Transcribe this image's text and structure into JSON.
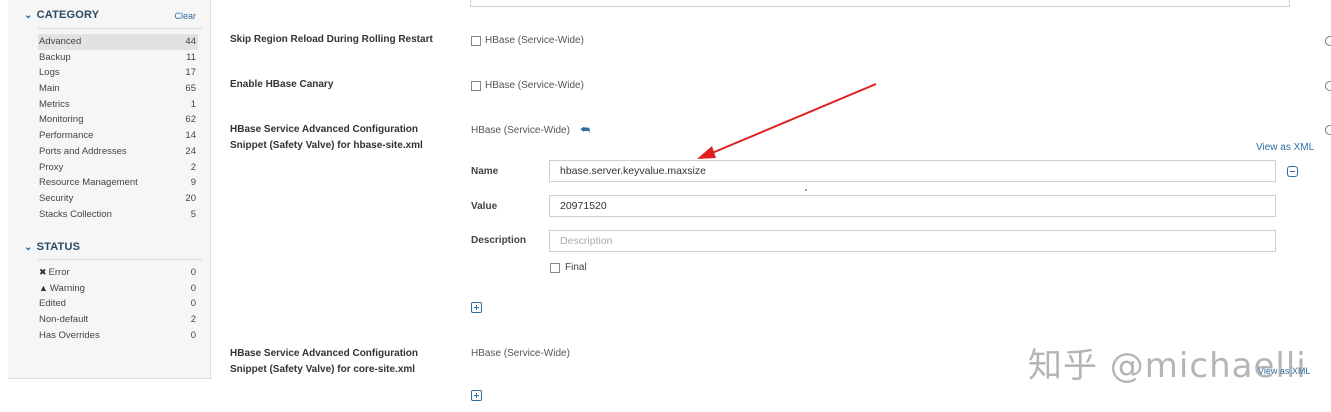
{
  "sidebar": {
    "category_header": "CATEGORY",
    "clear_label": "Clear",
    "categories": [
      {
        "label": "Advanced",
        "count": "44"
      },
      {
        "label": "Backup",
        "count": "11"
      },
      {
        "label": "Logs",
        "count": "17"
      },
      {
        "label": "Main",
        "count": "65"
      },
      {
        "label": "Metrics",
        "count": "1"
      },
      {
        "label": "Monitoring",
        "count": "62"
      },
      {
        "label": "Performance",
        "count": "14"
      },
      {
        "label": "Ports and Addresses",
        "count": "24"
      },
      {
        "label": "Proxy",
        "count": "2"
      },
      {
        "label": "Resource Management",
        "count": "9"
      },
      {
        "label": "Security",
        "count": "20"
      },
      {
        "label": "Stacks Collection",
        "count": "5"
      }
    ],
    "status_header": "STATUS",
    "statuses": [
      {
        "label": "Error",
        "count": "0",
        "icon": "error-icon"
      },
      {
        "label": "Warning",
        "count": "0",
        "icon": "warning-icon"
      },
      {
        "label": "Edited",
        "count": "0"
      },
      {
        "label": "Non-default",
        "count": "2"
      },
      {
        "label": "Has Overrides",
        "count": "0"
      }
    ]
  },
  "main": {
    "props": [
      {
        "label": "Skip Region Reload During Rolling Restart",
        "scope": "HBase (Service-Wide)"
      },
      {
        "label": "Enable HBase Canary",
        "scope": "HBase (Service-Wide)"
      },
      {
        "label_line1": "HBase Service Advanced Configuration",
        "label_line2": "Snippet (Safety Valve) for hbase-site.xml",
        "scope": "HBase (Service-Wide)"
      },
      {
        "label_line1": "HBase Service Advanced Configuration",
        "label_line2": "Snippet (Safety Valve) for core-site.xml",
        "scope": "HBase (Service-Wide)"
      }
    ],
    "view_as_xml": "View as XML",
    "name_label": "Name",
    "name_value": "hbase.server.keyvalue.maxsize",
    "value_label": "Value",
    "value_value": "20971520",
    "description_label": "Description",
    "description_placeholder": "Description",
    "final_label": "Final",
    "watermark": "知乎 @michaelli",
    "watermark_overlap": "View as XML"
  },
  "colors": {
    "accent": "#2e6da4",
    "arrow": "#e02020"
  }
}
